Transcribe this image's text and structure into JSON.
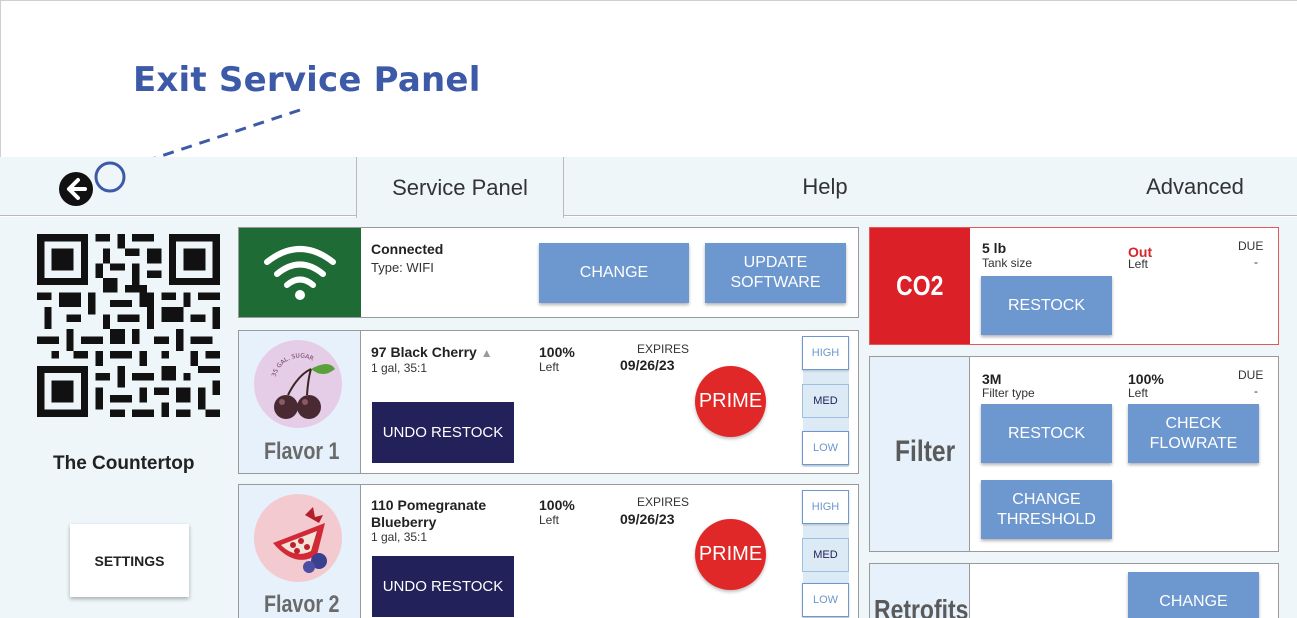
{
  "annotation": {
    "exit_label": "Exit Service Panel"
  },
  "tabs": {
    "service_panel": "Service Panel",
    "help": "Help",
    "advanced": "Advanced"
  },
  "sidebar": {
    "location_name": "The Countertop",
    "settings_label": "SETTINGS"
  },
  "wifi": {
    "status": "Connected",
    "type": "Type: WIFI",
    "change_label": "CHANGE",
    "update_label_1": "UPDATE",
    "update_label_2": "SOFTWARE",
    "tile_color": "#1f6b35"
  },
  "flavors": [
    {
      "slot_label": "Flavor 1",
      "name": "97 Black Cherry",
      "detail": "1 gal, 35:1",
      "level_value": "100%",
      "level_label": "Left",
      "expires_label": "EXPIRES",
      "expires_date": "09/26/23",
      "undo_label": "UNDO RESTOCK",
      "prime_label": "PRIME",
      "levels": [
        "HIGH",
        "MED",
        "LOW"
      ],
      "selected_level": "MED",
      "image_caption": "35 GAL. SUGAR"
    },
    {
      "slot_label": "Flavor 2",
      "name_line_1": "110 Pomegranate",
      "name_line_2": "Blueberry",
      "detail": "1 gal, 35:1",
      "level_value": "100%",
      "level_label": "Left",
      "expires_label": "EXPIRES",
      "expires_date": "09/26/23",
      "undo_label": "UNDO RESTOCK",
      "prime_label": "PRIME",
      "levels": [
        "HIGH",
        "MED",
        "LOW"
      ],
      "selected_level": "MED"
    }
  ],
  "co2": {
    "title": "CO2",
    "size_value": "5 lb",
    "size_label": "Tank size",
    "status_value": "Out",
    "status_label": "Left",
    "due_label": "DUE",
    "due_value": "-",
    "restock_label": "RESTOCK",
    "tile_color": "#db2127"
  },
  "filter": {
    "title": "Filter",
    "type_value": "3M",
    "type_label": "Filter type",
    "level_value": "100%",
    "level_label": "Left",
    "due_label": "DUE",
    "due_value": "-",
    "restock_label": "RESTOCK",
    "flowrate_label_1": "CHECK",
    "flowrate_label_2": "FLOWRATE",
    "threshold_label_1": "CHANGE",
    "threshold_label_2": "THRESHOLD"
  },
  "retrofits": {
    "title": "Retrofits",
    "change_label": "CHANGE"
  }
}
